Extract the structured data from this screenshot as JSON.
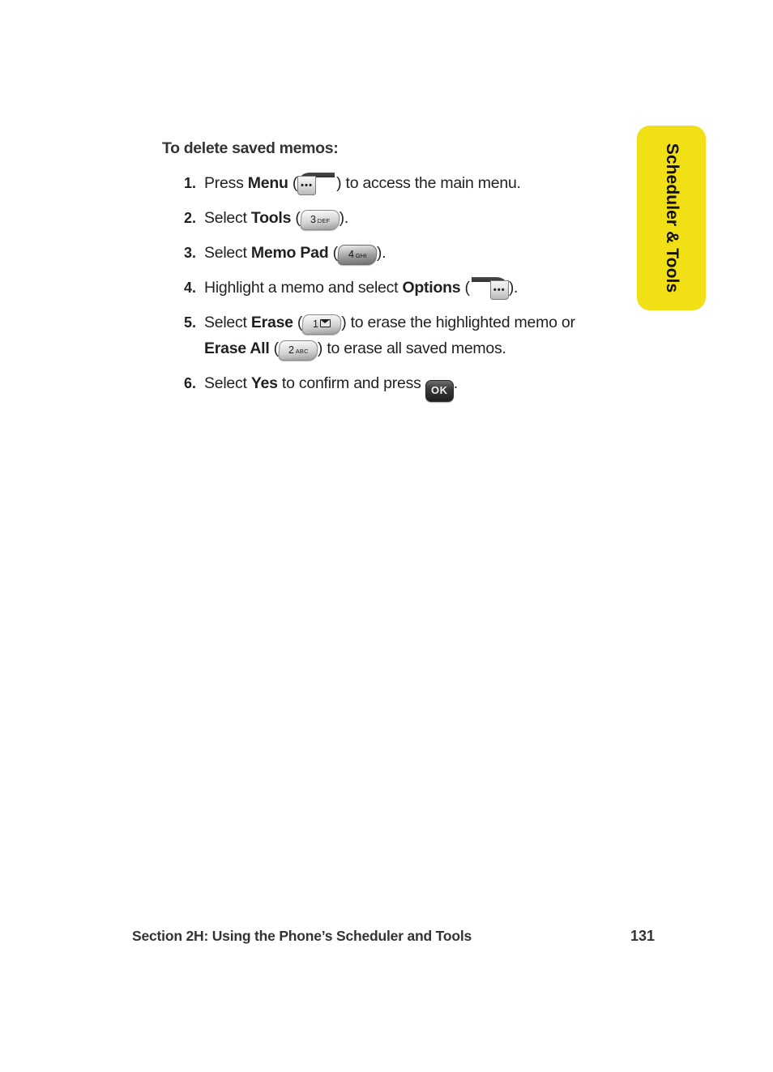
{
  "page": {
    "heading": "To delete saved memos:",
    "side_tab_label": "Scheduler & Tools",
    "side_tab_color": "#f2e017",
    "text_color": "#231f20",
    "heading_color": "#333333"
  },
  "steps": [
    {
      "number": "1.",
      "parts": [
        {
          "type": "text",
          "value": "Press "
        },
        {
          "type": "bold",
          "value": "Menu"
        },
        {
          "type": "text",
          "value": " ("
        },
        {
          "type": "key",
          "key": "softkey-left",
          "label": "•••"
        },
        {
          "type": "text",
          "value": ") to access the main menu."
        }
      ]
    },
    {
      "number": "2.",
      "parts": [
        {
          "type": "text",
          "value": "Select "
        },
        {
          "type": "bold",
          "value": "Tools"
        },
        {
          "type": "text",
          "value": " ("
        },
        {
          "type": "key",
          "key": "keycap",
          "digit": "3",
          "letters": "DEF"
        },
        {
          "type": "text",
          "value": ")."
        }
      ]
    },
    {
      "number": "3.",
      "parts": [
        {
          "type": "text",
          "value": "Select "
        },
        {
          "type": "bold",
          "value": "Memo Pad"
        },
        {
          "type": "text",
          "value": " ("
        },
        {
          "type": "key",
          "key": "keycap-dark",
          "digit": "4",
          "letters": "GHI"
        },
        {
          "type": "text",
          "value": ")."
        }
      ]
    },
    {
      "number": "4.",
      "parts": [
        {
          "type": "text",
          "value": "Highlight a memo and select "
        },
        {
          "type": "bold",
          "value": "Options"
        },
        {
          "type": "text",
          "value": " ("
        },
        {
          "type": "key",
          "key": "softkey-right",
          "label": "•••"
        },
        {
          "type": "text",
          "value": ")."
        }
      ]
    },
    {
      "number": "5.",
      "parts": [
        {
          "type": "text",
          "value": "Select "
        },
        {
          "type": "bold",
          "value": "Erase"
        },
        {
          "type": "text",
          "value": " ("
        },
        {
          "type": "key",
          "key": "keycap-envelope",
          "digit": "1",
          "letters": ""
        },
        {
          "type": "text",
          "value": ") to erase the highlighted memo or "
        },
        {
          "type": "bold",
          "value": "Erase All"
        },
        {
          "type": "text",
          "value": " ("
        },
        {
          "type": "key",
          "key": "keycap",
          "digit": "2",
          "letters": "ABC"
        },
        {
          "type": "text",
          "value": ") to erase all saved memos."
        }
      ]
    },
    {
      "number": "6.",
      "parts": [
        {
          "type": "text",
          "value": "Select "
        },
        {
          "type": "bold",
          "value": "Yes"
        },
        {
          "type": "text",
          "value": " to confirm and press "
        },
        {
          "type": "key",
          "key": "ok",
          "label": "OK"
        },
        {
          "type": "text",
          "value": "."
        }
      ]
    }
  ],
  "footer": {
    "title": "Section 2H: Using the Phone’s Scheduler and Tools",
    "page_number": "131"
  }
}
